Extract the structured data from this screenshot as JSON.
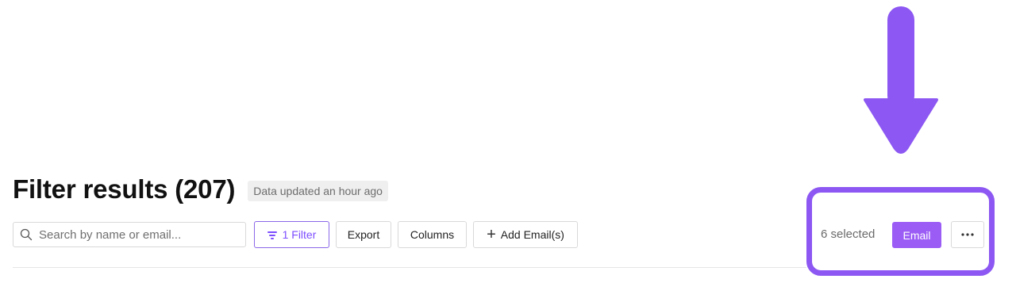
{
  "header": {
    "title": "Filter results (207)",
    "updated_badge": "Data updated an hour ago"
  },
  "toolbar": {
    "search_placeholder": "Search by name or email...",
    "filter_label": "1 Filter",
    "export_label": "Export",
    "columns_label": "Columns",
    "add_email_label": "Add Email(s)"
  },
  "selection": {
    "count_text": "6 selected",
    "email_label": "Email"
  },
  "icons": {
    "search": "search-icon",
    "filter": "filter-icon",
    "plus": "plus-icon",
    "more": "more-horizontal-icon",
    "arrow": "down-arrow-annotation"
  },
  "colors": {
    "accent": "#9b5cf5",
    "annotation": "#8c57f2",
    "filter_border": "#8b67e8"
  }
}
